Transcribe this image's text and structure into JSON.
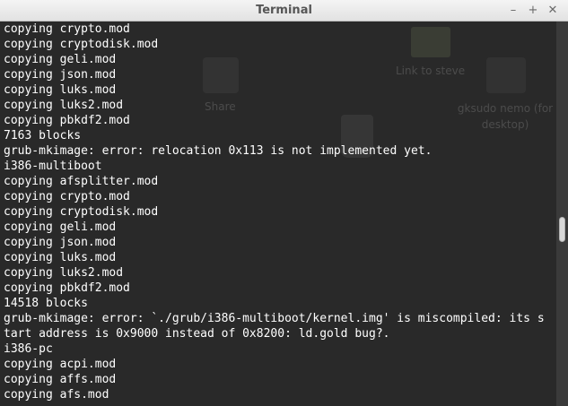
{
  "window": {
    "title": "Terminal",
    "controls": {
      "minimize": "–",
      "maximize": "+",
      "close": "✕"
    }
  },
  "desktop_ghosts": {
    "link_label": "Link to steve",
    "share_label": "Share",
    "app_label": "gksudo nemo (for desktop)"
  },
  "terminal": {
    "lines": [
      "copying crypto.mod",
      "copying cryptodisk.mod",
      "copying geli.mod",
      "copying json.mod",
      "copying luks.mod",
      "copying luks2.mod",
      "copying pbkdf2.mod",
      "7163 blocks",
      "grub-mkimage: error: relocation 0x113 is not implemented yet.",
      "i386-multiboot",
      "copying afsplitter.mod",
      "copying crypto.mod",
      "copying cryptodisk.mod",
      "copying geli.mod",
      "copying json.mod",
      "copying luks.mod",
      "copying luks2.mod",
      "copying pbkdf2.mod",
      "14518 blocks",
      "grub-mkimage: error: `./grub/i386-multiboot/kernel.img' is miscompiled: its s",
      "tart address is 0x9000 instead of 0x8200: ld.gold bug?.",
      "i386-pc",
      "copying acpi.mod",
      "copying affs.mod",
      "copying afs.mod"
    ]
  }
}
